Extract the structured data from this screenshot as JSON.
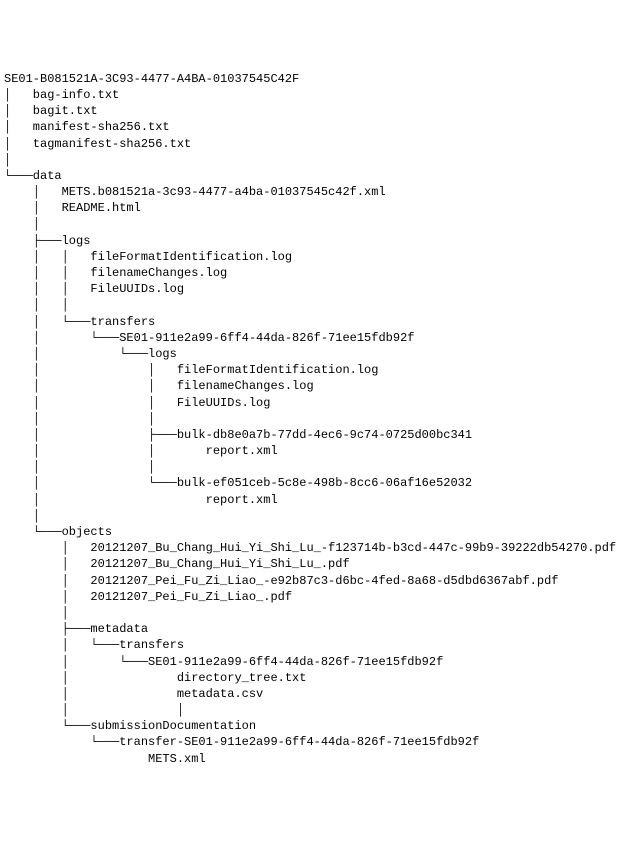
{
  "lines": [
    "SE01-B081521A-3C93-4477-A4BA-01037545C42F",
    "│   bag-info.txt",
    "│   bagit.txt",
    "│   manifest-sha256.txt",
    "│   tagmanifest-sha256.txt",
    "│",
    "└───data",
    "    │   METS.b081521a-3c93-4477-a4ba-01037545c42f.xml",
    "    │   README.html",
    "    │",
    "    ├───logs",
    "    │   │   fileFormatIdentification.log",
    "    │   │   filenameChanges.log",
    "    │   │   FileUUIDs.log",
    "    │   │",
    "    │   └───transfers",
    "    │       └───SE01-911e2a99-6ff4-44da-826f-71ee15fdb92f",
    "    │           └───logs",
    "    │               │   fileFormatIdentification.log",
    "    │               │   filenameChanges.log",
    "    │               │   FileUUIDs.log",
    "    │               │",
    "    │               ├───bulk-db8e0a7b-77dd-4ec6-9c74-0725d00bc341",
    "    │               │       report.xml",
    "    │               │",
    "    │               └───bulk-ef051ceb-5c8e-498b-8cc6-06af16e52032",
    "    │                       report.xml",
    "    │",
    "    └───objects",
    "        │   20121207_Bu_Chang_Hui_Yi_Shi_Lu_-f123714b-b3cd-447c-99b9-39222db54270.pdf",
    "        │   20121207_Bu_Chang_Hui_Yi_Shi_Lu_.pdf",
    "        │   20121207_Pei_Fu_Zi_Liao_-e92b87c3-d6bc-4fed-8a68-d5dbd6367abf.pdf",
    "        │   20121207_Pei_Fu_Zi_Liao_.pdf",
    "        │",
    "        ├───metadata",
    "        │   └───transfers",
    "        │       └───SE01-911e2a99-6ff4-44da-826f-71ee15fdb92f",
    "        │               directory_tree.txt",
    "        │               metadata.csv",
    "        │               │",
    "        └───submissionDocumentation",
    "            └───transfer-SE01-911e2a99-6ff4-44da-826f-71ee15fdb92f",
    "                    METS.xml"
  ]
}
